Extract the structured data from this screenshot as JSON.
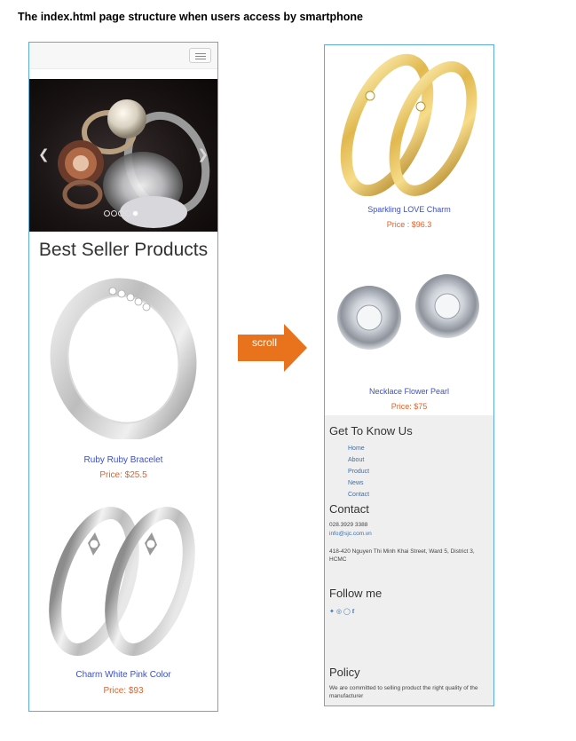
{
  "caption": "The index.html page structure when users access by smartphone",
  "left_phone": {
    "section_title": "Best Seller Products",
    "products": [
      {
        "name": "Ruby Ruby Bracelet",
        "price": "Price: $25.5"
      },
      {
        "name": "Charm White Pink Color",
        "price": "Price: $93"
      }
    ],
    "carousel": {
      "prev_icon": "chevron-left-icon",
      "next_icon": "chevron-right-icon",
      "slide_count": 5,
      "active_slide": 5
    }
  },
  "scroll_label": "scroll",
  "right_phone": {
    "products": [
      {
        "name": "Sparkling LOVE Charm",
        "price": "Price : $96.3"
      },
      {
        "name": "Necklace Flower Pearl",
        "price": "Price: $75"
      }
    ],
    "footer": {
      "know_title": "Get To Know Us",
      "links": [
        "Home",
        "About",
        "Product",
        "News",
        "Contact"
      ],
      "contact_title": "Contact",
      "phone": "028.3929 3388",
      "email": "info@sjc.com.vn",
      "address": "418-420 Nguyen Thi Minh Khai Street, Ward 5, District 3, HCMC",
      "follow_title": "Follow me",
      "social_icons": [
        "twitter-icon",
        "dribbble-icon",
        "github-icon",
        "facebook-icon"
      ],
      "policy_title": "Policy",
      "policy_text": "We are committed to selling product the right quality of the manufacturer"
    }
  },
  "colors": {
    "frame_border": "#5aaed8",
    "product_name": "#3d4fc8",
    "price": "#e2612a",
    "arrow": "#e8731c",
    "footer_bg": "#efefef"
  }
}
